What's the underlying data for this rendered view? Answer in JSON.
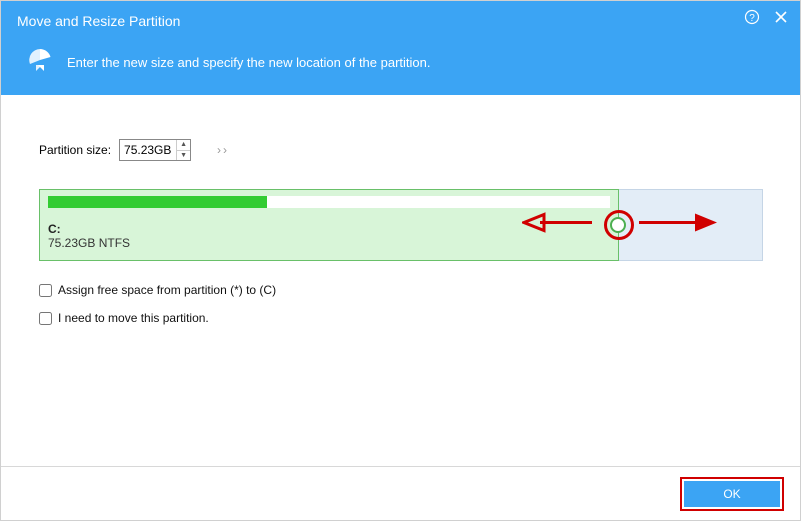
{
  "header": {
    "title": "Move and Resize Partition",
    "subtitle": "Enter the new size and specify the new location of the partition."
  },
  "size_row": {
    "label": "Partition size:",
    "value": "75.23GB"
  },
  "partition": {
    "label": "C:",
    "detail": "75.23GB NTFS"
  },
  "options": {
    "assign_free": "Assign free space from partition (*) to (C)",
    "need_move": "I need to move this partition."
  },
  "footer": {
    "ok": "OK"
  }
}
